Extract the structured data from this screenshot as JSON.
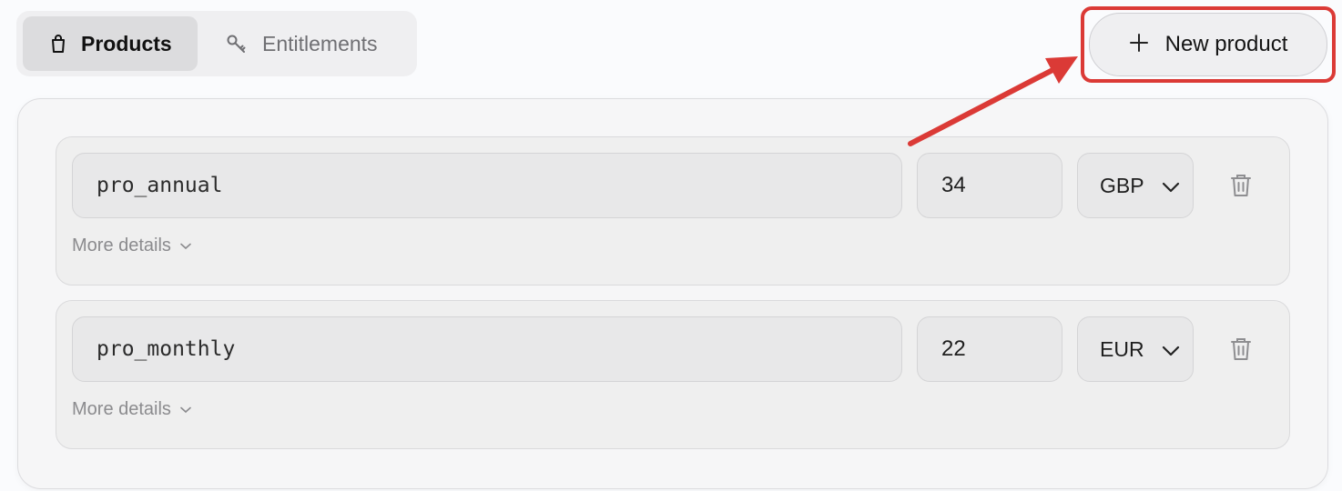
{
  "tabs": [
    {
      "label": "Products",
      "icon": "shopping-bag-icon",
      "active": true
    },
    {
      "label": "Entitlements",
      "icon": "key-icon",
      "active": false
    }
  ],
  "header": {
    "new_button_label": "New product",
    "new_button_icon": "plus-icon"
  },
  "products": [
    {
      "name": "pro_annual",
      "price": "34",
      "currency": "GBP",
      "more_label": "More details"
    },
    {
      "name": "pro_monthly",
      "price": "22",
      "currency": "EUR",
      "more_label": "More details"
    }
  ],
  "annotation": {
    "color": "#db3a36"
  }
}
